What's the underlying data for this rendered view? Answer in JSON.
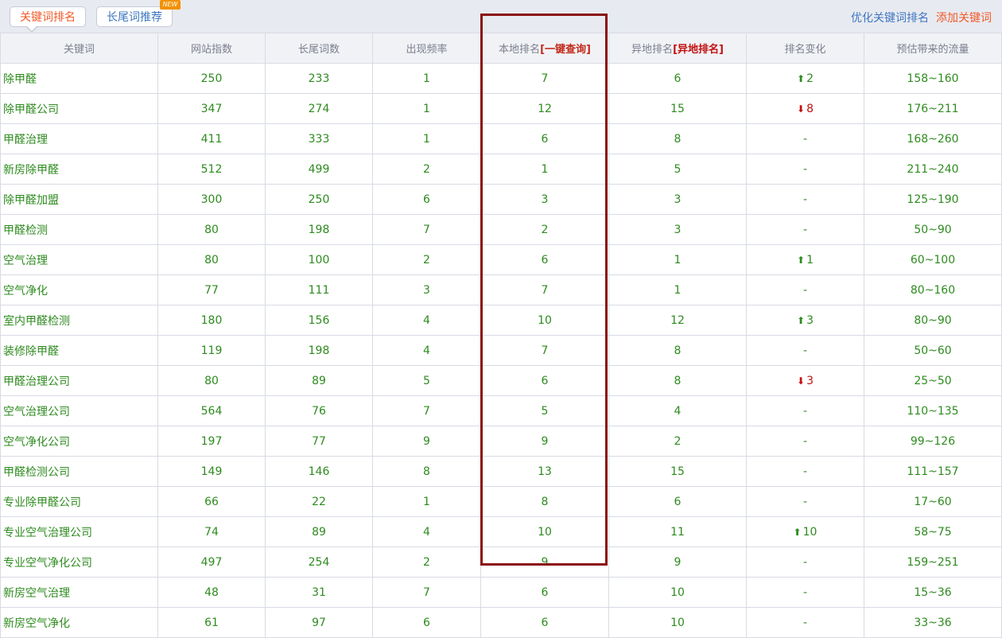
{
  "tabs": {
    "active_label": "关键词排名",
    "second_label": "长尾词推荐",
    "badge": "NEW"
  },
  "top_links": {
    "optimize": "优化关键词排名",
    "add": "添加关键词"
  },
  "table": {
    "headers": {
      "keyword": "关键词",
      "index": "网站指数",
      "longtail": "长尾词数",
      "frequency": "出现频率",
      "local_rank": "本地排名",
      "local_rank_link": "[一键查询]",
      "remote_rank": "异地排名",
      "remote_rank_link": "[异地排名]",
      "change": "排名变化",
      "traffic": "预估带来的流量"
    },
    "rows": [
      {
        "kw": "除甲醛",
        "idx": "250",
        "lt": "233",
        "freq": "1",
        "local": "7",
        "remote": "6",
        "dir": "up",
        "chg": "2",
        "traffic": "158~160"
      },
      {
        "kw": "除甲醛公司",
        "idx": "347",
        "lt": "274",
        "freq": "1",
        "local": "12",
        "remote": "15",
        "dir": "down",
        "chg": "8",
        "traffic": "176~211"
      },
      {
        "kw": "甲醛治理",
        "idx": "411",
        "lt": "333",
        "freq": "1",
        "local": "6",
        "remote": "8",
        "dir": "none",
        "chg": "-",
        "traffic": "168~260"
      },
      {
        "kw": "新房除甲醛",
        "idx": "512",
        "lt": "499",
        "freq": "2",
        "local": "1",
        "remote": "5",
        "dir": "none",
        "chg": "-",
        "traffic": "211~240"
      },
      {
        "kw": "除甲醛加盟",
        "idx": "300",
        "lt": "250",
        "freq": "6",
        "local": "3",
        "remote": "3",
        "dir": "none",
        "chg": "-",
        "traffic": "125~190"
      },
      {
        "kw": "甲醛检测",
        "idx": "80",
        "lt": "198",
        "freq": "7",
        "local": "2",
        "remote": "3",
        "dir": "none",
        "chg": "-",
        "traffic": "50~90"
      },
      {
        "kw": "空气治理",
        "idx": "80",
        "lt": "100",
        "freq": "2",
        "local": "6",
        "remote": "1",
        "dir": "up",
        "chg": "1",
        "traffic": "60~100"
      },
      {
        "kw": "空气净化",
        "idx": "77",
        "lt": "111",
        "freq": "3",
        "local": "7",
        "remote": "1",
        "dir": "none",
        "chg": "-",
        "traffic": "80~160"
      },
      {
        "kw": "室内甲醛检测",
        "idx": "180",
        "lt": "156",
        "freq": "4",
        "local": "10",
        "remote": "12",
        "dir": "up",
        "chg": "3",
        "traffic": "80~90"
      },
      {
        "kw": "装修除甲醛",
        "idx": "119",
        "lt": "198",
        "freq": "4",
        "local": "7",
        "remote": "8",
        "dir": "none",
        "chg": "-",
        "traffic": "50~60"
      },
      {
        "kw": "甲醛治理公司",
        "idx": "80",
        "lt": "89",
        "freq": "5",
        "local": "6",
        "remote": "8",
        "dir": "down",
        "chg": "3",
        "traffic": "25~50"
      },
      {
        "kw": "空气治理公司",
        "idx": "564",
        "lt": "76",
        "freq": "7",
        "local": "5",
        "remote": "4",
        "dir": "none",
        "chg": "-",
        "traffic": "110~135"
      },
      {
        "kw": "空气净化公司",
        "idx": "197",
        "lt": "77",
        "freq": "9",
        "local": "9",
        "remote": "2",
        "dir": "none",
        "chg": "-",
        "traffic": "99~126"
      },
      {
        "kw": "甲醛检测公司",
        "idx": "149",
        "lt": "146",
        "freq": "8",
        "local": "13",
        "remote": "15",
        "dir": "none",
        "chg": "-",
        "traffic": "111~157"
      },
      {
        "kw": "专业除甲醛公司",
        "idx": "66",
        "lt": "22",
        "freq": "1",
        "local": "8",
        "remote": "6",
        "dir": "none",
        "chg": "-",
        "traffic": "17~60"
      },
      {
        "kw": "专业空气治理公司",
        "idx": "74",
        "lt": "89",
        "freq": "4",
        "local": "10",
        "remote": "11",
        "dir": "up",
        "chg": "10",
        "traffic": "58~75"
      },
      {
        "kw": "专业空气净化公司",
        "idx": "497",
        "lt": "254",
        "freq": "2",
        "local": "9",
        "remote": "9",
        "dir": "none",
        "chg": "-",
        "traffic": "159~251"
      },
      {
        "kw": "新房空气治理",
        "idx": "48",
        "lt": "31",
        "freq": "7",
        "local": "6",
        "remote": "10",
        "dir": "none",
        "chg": "-",
        "traffic": "15~36"
      },
      {
        "kw": "新房空气净化",
        "idx": "61",
        "lt": "97",
        "freq": "6",
        "local": "6",
        "remote": "10",
        "dir": "none",
        "chg": "-",
        "traffic": "33~36"
      }
    ]
  },
  "colors": {
    "value_green": "#2e8b1f",
    "accent_orange": "#f05a28",
    "link_blue": "#3d76c0",
    "highlight_box": "#8a0e0e",
    "down_red": "#c21010"
  }
}
